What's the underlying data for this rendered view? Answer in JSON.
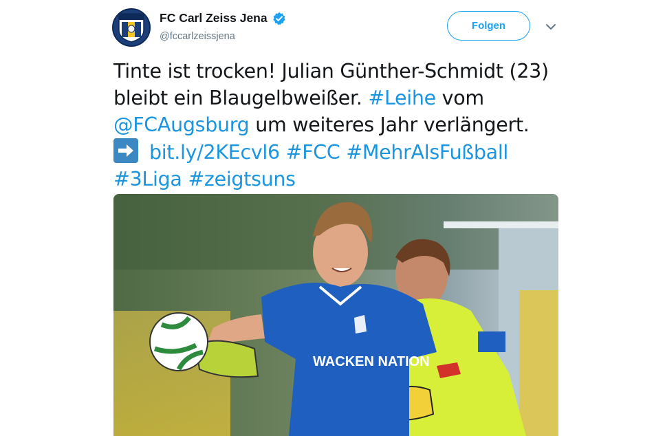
{
  "account": {
    "display_name": "FC Carl Zeiss Jena",
    "handle": "@fccarlzeissjena",
    "verified": true,
    "avatar_icon": "fc-carl-zeiss-jena-crest"
  },
  "follow_label": "Folgen",
  "tweet": {
    "line1": "Tinte ist trocken! Julian Günther-Schmidt (23)",
    "line2_text": "bleibt ein Blaugelbweißer. ",
    "line2_tag": "#Leihe",
    "line2_end": " vom",
    "line3_mention": "@FCAugsburg",
    "line3_text": " um weiteres Jahr verlängert.",
    "line4_link": "bit.ly/2KEcvl6",
    "line4_tag1": "#FCC",
    "line4_tag2": "#MehrAlsFußball",
    "line5_tag1": "#3Liga",
    "line5_tag2": "#zeigtsuns"
  },
  "jersey_text": "WACKEN NATION",
  "colors": {
    "link": "#1b95e0",
    "follow_border": "#1da1f2",
    "handle": "#657786",
    "jersey_blue": "#1f5fbf",
    "keeper_yellow": "#d8ef3a"
  }
}
